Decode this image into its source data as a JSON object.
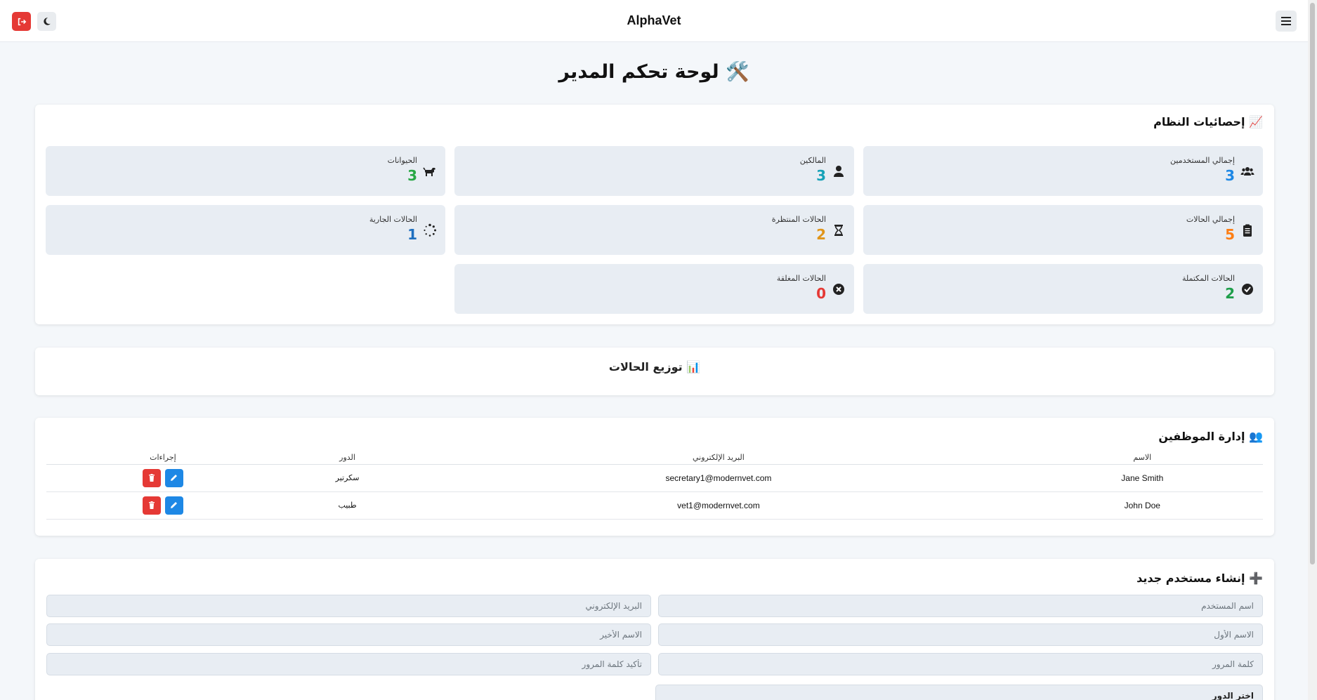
{
  "app": {
    "brand": "AlphaVet"
  },
  "header": {
    "logout_icon": "logout-icon",
    "theme_icon": "moon-icon",
    "menu_icon": "hamburger-icon"
  },
  "page": {
    "title": "🛠️ لوحة تحكم المدير"
  },
  "stats": {
    "title": "📈 إحصائيات النظام",
    "items": [
      {
        "label": "إجمالي المستخدمين",
        "value": "3",
        "color": "#1e88e5",
        "icon": "users-icon"
      },
      {
        "label": "المالكين",
        "value": "3",
        "color": "#17a2b8",
        "icon": "user-icon"
      },
      {
        "label": "الحيوانات",
        "value": "3",
        "color": "#28a745",
        "icon": "dog-icon"
      },
      {
        "label": "إجمالي الحالات",
        "value": "5",
        "color": "#fd7e14",
        "icon": "clipboard-icon"
      },
      {
        "label": "الحالات المنتظرة",
        "value": "2",
        "color": "#e0951a",
        "icon": "hourglass-icon"
      },
      {
        "label": "الحالات الجارية",
        "value": "1",
        "color": "#1e6fbf",
        "icon": "spinner-icon"
      },
      {
        "label": "الحالات المكتملة",
        "value": "2",
        "color": "#1e9e4a",
        "icon": "check-circle-icon"
      },
      {
        "label": "الحالات المغلقة",
        "value": "0",
        "color": "#e53935",
        "icon": "x-circle-icon"
      }
    ]
  },
  "distribution": {
    "title": "📊 توزيع الحالات"
  },
  "staff": {
    "title": "👥 إدارة الموظفين",
    "columns": [
      "الاسم",
      "البريد الإلكتروني",
      "الدور",
      "إجراءات"
    ],
    "rows": [
      {
        "name": "Jane Smith",
        "email": "secretary1@modernvet.com",
        "role": "سكرتير"
      },
      {
        "name": "John Doe",
        "email": "vet1@modernvet.com",
        "role": "طبيب"
      }
    ]
  },
  "create_user": {
    "title": "➕ إنشاء مستخدم جديد",
    "username_placeholder": "اسم المستخدم",
    "email_placeholder": "البريد الإلكتروني",
    "first_name_placeholder": "الاسم الأول",
    "last_name_placeholder": "الاسم الأخير",
    "password_placeholder": "كلمة المرور",
    "confirm_password_placeholder": "تأكيد كلمة المرور",
    "role_select": "اختر الدور"
  }
}
